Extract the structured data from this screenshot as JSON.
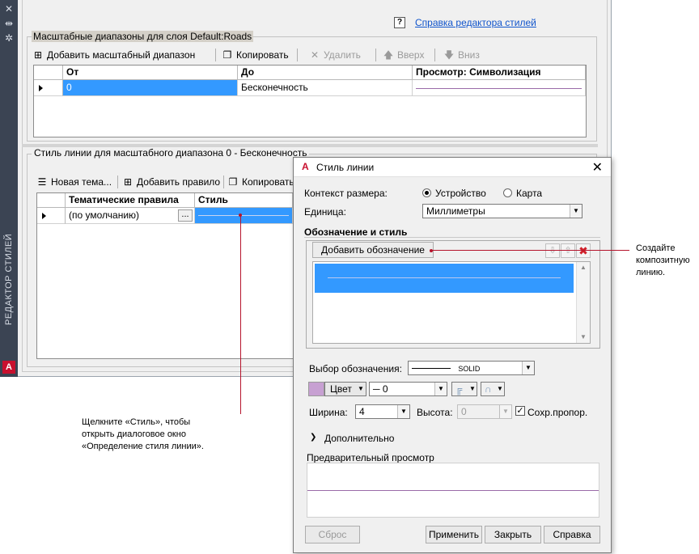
{
  "palette": {
    "title": "РЕДАКТОР СТИЛЕЙ",
    "icons": [
      "close-icon",
      "pin-icon",
      "settings-icon"
    ]
  },
  "editor": {
    "help_link": "Справка редактора стилей",
    "scale_group": {
      "title": "Масштабные диапазоны для слоя Default:Roads",
      "toolbar": {
        "add": "Добавить масштабный диапазон",
        "copy": "Копировать",
        "delete": "Удалить",
        "up": "Вверх",
        "down": "Вниз"
      },
      "columns": [
        "От",
        "До",
        "Просмотр: Символизация"
      ],
      "rows": [
        {
          "from": "0",
          "to": "Бесконечность"
        }
      ]
    },
    "line_group": {
      "title": "Стиль линии для масштабного диапазона 0 - Бесконечность",
      "toolbar": {
        "new_theme": "Новая тема...",
        "add_rule": "Добавить правило",
        "copy": "Копировать"
      },
      "columns": [
        "Тематические правила",
        "Стиль"
      ],
      "rows": [
        {
          "rule": "(по умолчанию)",
          "ellipsis": "..."
        }
      ]
    }
  },
  "dialog": {
    "title": "Стиль линии",
    "size_context_label": "Контекст размера:",
    "size_context_options": [
      "Устройство",
      "Карта"
    ],
    "size_context_selected": "Устройство",
    "unit_label": "Единица:",
    "unit_value": "Миллиметры",
    "section_title": "Обозначение и стиль",
    "add_symbol_button": "Добавить обозначение",
    "symbol_label": "Выбор обозначения:",
    "symbol_value": "SOLID",
    "color_button": "Цвет",
    "thickness_value": "0",
    "width_label": "Ширина:",
    "width_value": "4",
    "height_label": "Высота:",
    "height_value": "0",
    "keep_proportion": "Сохр.пропор.",
    "keep_proportion_checked": true,
    "advanced": "Дополнительно",
    "preview_label": "Предварительный просмотр",
    "buttons": {
      "reset": "Сброс",
      "apply": "Применить",
      "close": "Закрыть",
      "help": "Справка"
    }
  },
  "callouts": {
    "composite": "Создайте\nкомпозитную\nлинию.",
    "style": "Щелкните «Стиль», чтобы\nоткрыть диалоговое окно\n«Определение стиля линии»."
  },
  "colors": {
    "selection_blue": "#3399ff",
    "callout_red": "#b5142c",
    "preview_line": "#9a6aa8",
    "color_swatch": "#c7a0d2"
  }
}
